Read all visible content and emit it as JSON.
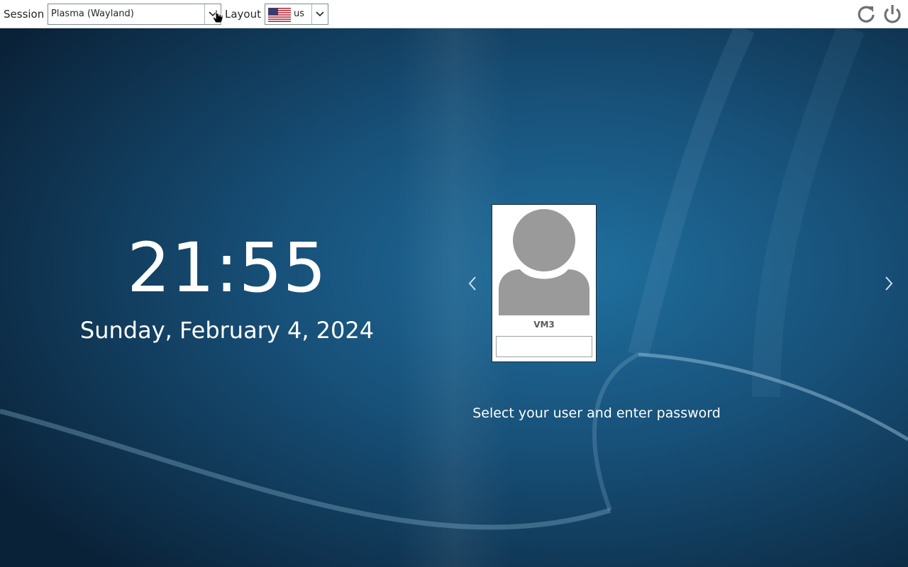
{
  "topbar": {
    "session_label": "Session",
    "session_value": "Plasma (Wayland)",
    "layout_label": "Layout",
    "layout_value": "us",
    "layout_flag": "us-flag-icon",
    "actions": [
      {
        "name": "reboot",
        "icon": "reboot-icon"
      },
      {
        "name": "shutdown",
        "icon": "power-icon"
      }
    ]
  },
  "clock": {
    "time": "21:55",
    "date": "Sunday, February 4, 2024"
  },
  "login": {
    "username": "VM3",
    "password_value": "",
    "prompt": "Select your user and enter password",
    "prev_icon": "chevron-left-icon",
    "next_icon": "chevron-right-icon",
    "avatar_icon": "default-user-avatar"
  },
  "colors": {
    "background_dark": "#0d2f4c",
    "background_light": "#1f6d9f",
    "topbar": "#ffffff",
    "avatar_gray": "#9a9a9a"
  }
}
